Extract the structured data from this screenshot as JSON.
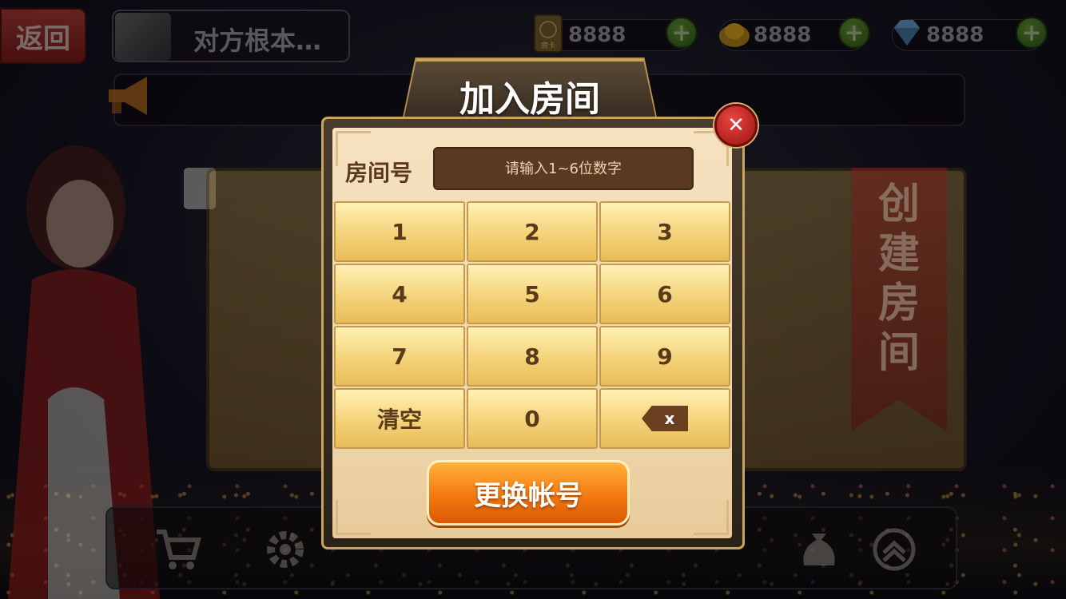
{
  "topbar": {
    "back_label": "返回",
    "user_name": "对方根本…",
    "room_card_label": "房卡",
    "room_cards": "8888",
    "gold": "8888",
    "diamonds": "8888",
    "plus_label": "+"
  },
  "background": {
    "create_room_label": "创建房间"
  },
  "dialog": {
    "title": "加入房间",
    "room_label": "房间号",
    "room_input_placeholder": "请输入1~6位数字",
    "room_input_value": "",
    "keys": [
      "1",
      "2",
      "3",
      "4",
      "5",
      "6",
      "7",
      "8",
      "9",
      "清空",
      "0"
    ],
    "backspace_symbol": "x",
    "close_symbol": "✕",
    "switch_account_label": "更换帐号"
  }
}
